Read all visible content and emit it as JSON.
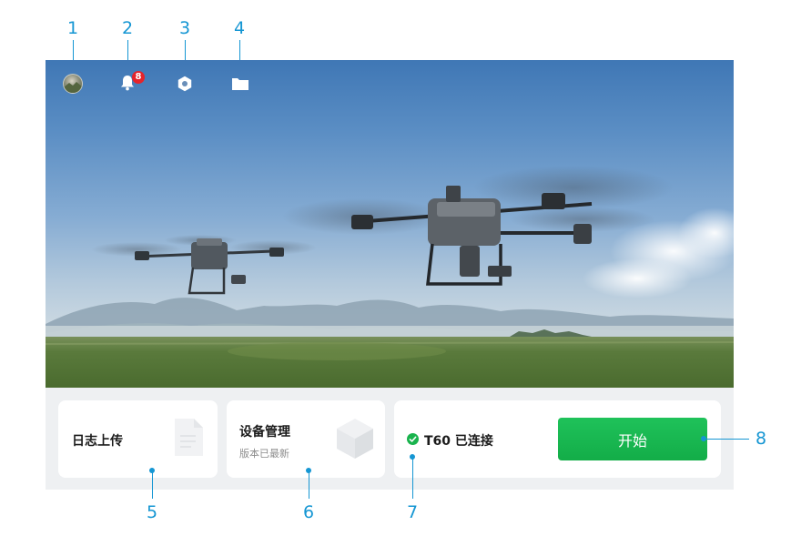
{
  "callouts": {
    "top": [
      "1",
      "2",
      "3",
      "4"
    ],
    "bottom": [
      "5",
      "6",
      "7"
    ],
    "right": "8"
  },
  "top_bar": {
    "notification_count": "8",
    "icons": [
      "avatar",
      "bell-icon",
      "settings-hexagon-icon",
      "folder-icon"
    ]
  },
  "cards": {
    "log_upload": {
      "title": "日志上传",
      "icon": "document-icon"
    },
    "device_mgmt": {
      "title": "设备管理",
      "subtitle": "版本已最新",
      "icon": "cube-icon"
    },
    "connection": {
      "status": "T60 已连接",
      "icon": "check-circle-icon",
      "start_label": "开始"
    }
  },
  "colors": {
    "callout": "#1596d3",
    "start_button": "#1ab851",
    "badge": "#e5242b",
    "check": "#19b34d"
  }
}
